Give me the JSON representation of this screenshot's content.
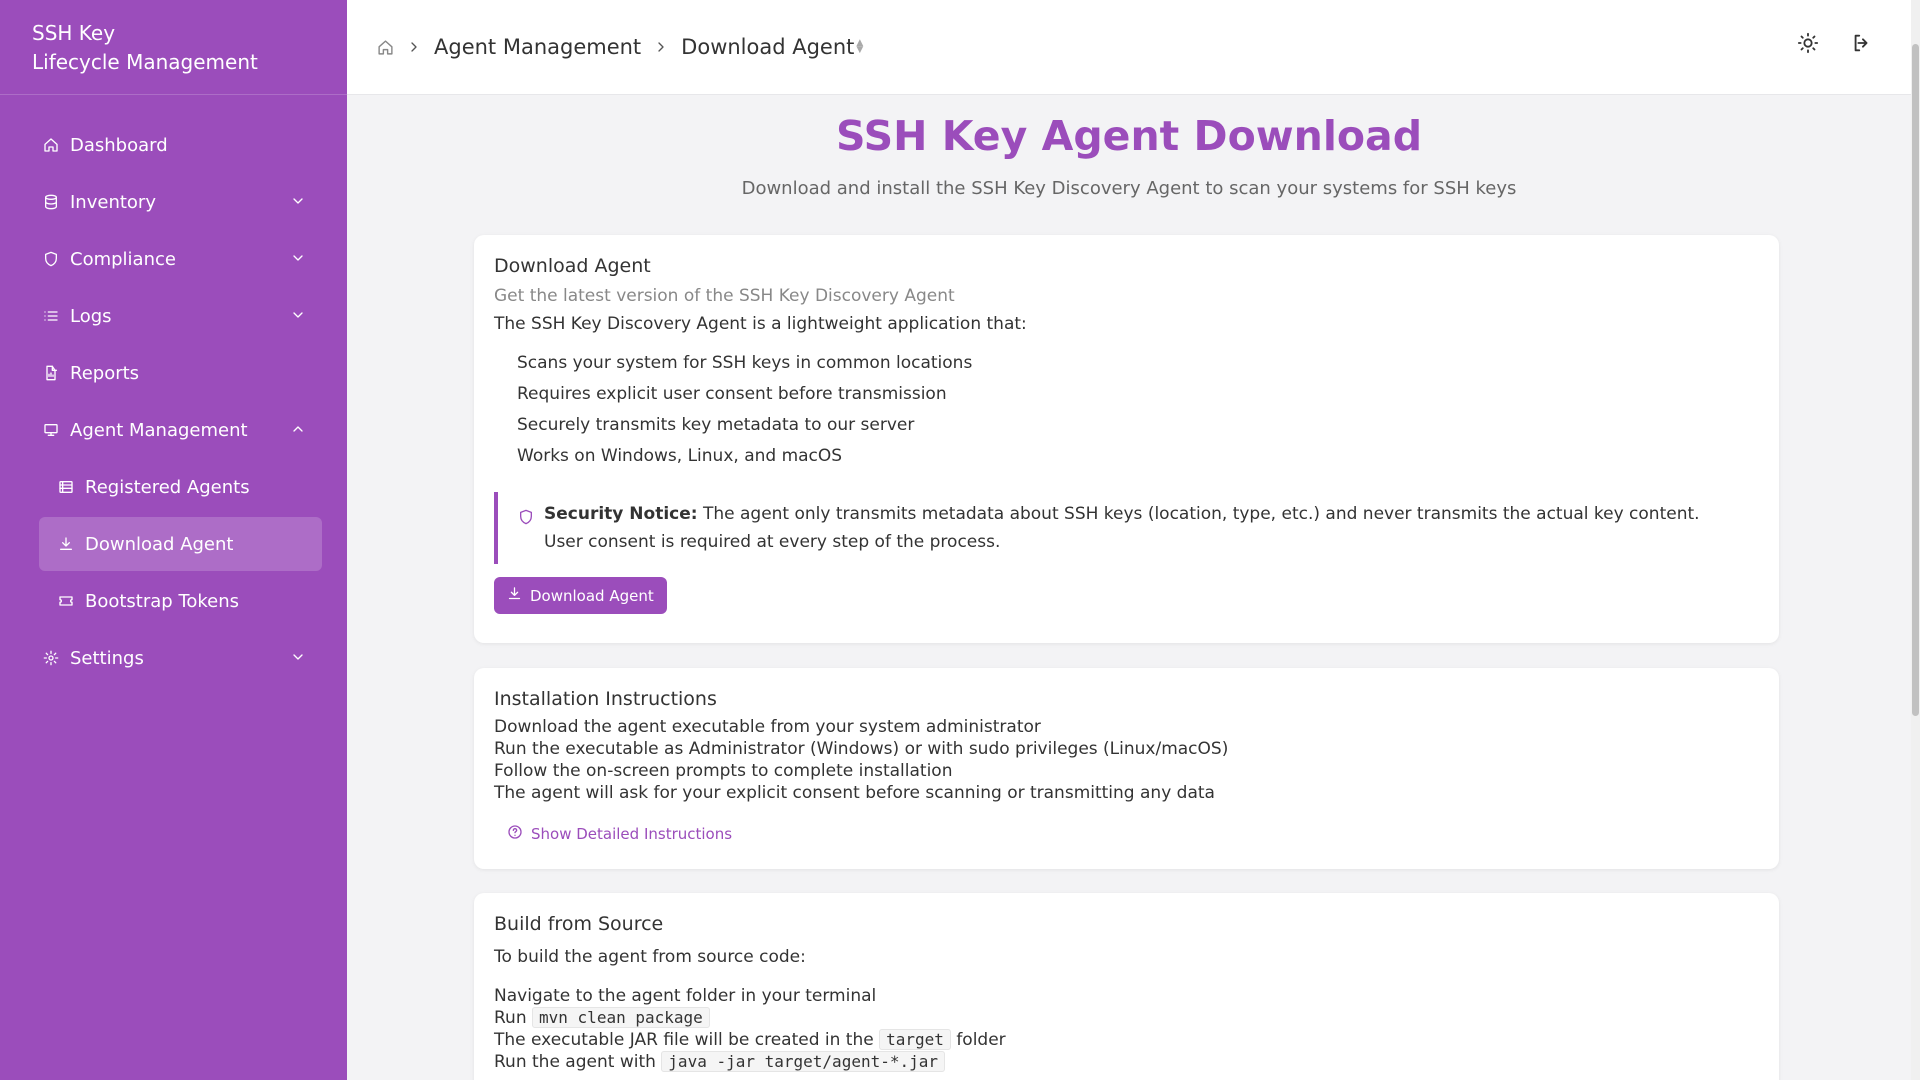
{
  "brand": {
    "line1": "SSH Key",
    "line2": "Lifecycle Management"
  },
  "sidebar": {
    "items": [
      {
        "label": "Dashboard"
      },
      {
        "label": "Inventory"
      },
      {
        "label": "Compliance"
      },
      {
        "label": "Logs"
      },
      {
        "label": "Reports"
      },
      {
        "label": "Agent Management"
      },
      {
        "label": "Registered Agents"
      },
      {
        "label": "Download Agent"
      },
      {
        "label": "Bootstrap Tokens"
      },
      {
        "label": "Settings"
      }
    ]
  },
  "breadcrumb": {
    "parent": "Agent Management",
    "current": "Download Agent"
  },
  "page": {
    "title": "SSH Key Agent Download",
    "subtitle": "Download and install the SSH Key Discovery Agent to scan your systems for SSH keys"
  },
  "download_card": {
    "title": "Download Agent",
    "subtitle": "Get the latest version of the SSH Key Discovery Agent",
    "intro": "The SSH Key Discovery Agent is a lightweight application that:",
    "features": [
      "Scans your system for SSH keys in common locations",
      "Requires explicit user consent before transmission",
      "Securely transmits key metadata to our server",
      "Works on Windows, Linux, and macOS"
    ],
    "notice_label": "Security Notice:",
    "notice_text": "The agent only transmits metadata about SSH keys (location, type, etc.) and never transmits the actual key content. User consent is required at every step of the process.",
    "button_label": "Download Agent"
  },
  "install_card": {
    "title": "Installation Instructions",
    "steps": [
      "Download the agent executable from your system administrator",
      "Run the executable as Administrator (Windows) or with sudo privileges (Linux/macOS)",
      "Follow the on-screen prompts to complete installation",
      "The agent will ask for your explicit consent before scanning or transmitting any data"
    ],
    "details_label": "Show Detailed Instructions"
  },
  "build_card": {
    "title": "Build from Source",
    "intro": "To build the agent from source code:",
    "step1": "Navigate to the agent folder in your terminal",
    "step2_prefix": "Run",
    "step2_code": "mvn clean package",
    "step3_prefix": "The executable JAR file will be created in the",
    "step3_code": "target",
    "step3_suffix": "folder",
    "step4_prefix": "Run the agent with",
    "step4_code": "java -jar target/agent-*.jar"
  },
  "colors": {
    "accent": "#9b4dbb",
    "background": "#f3f3f5"
  },
  "icons": {
    "dashboard": "home-icon",
    "inventory": "database-icon",
    "compliance": "shield-icon",
    "logs": "list-icon",
    "reports": "file-chart-icon",
    "agent_management": "monitor-icon",
    "registered_agents": "server-list-icon",
    "download_agent": "download-icon",
    "bootstrap_tokens": "ticket-icon",
    "settings": "gear-icon",
    "theme": "sun-icon",
    "logout": "logout-icon"
  }
}
